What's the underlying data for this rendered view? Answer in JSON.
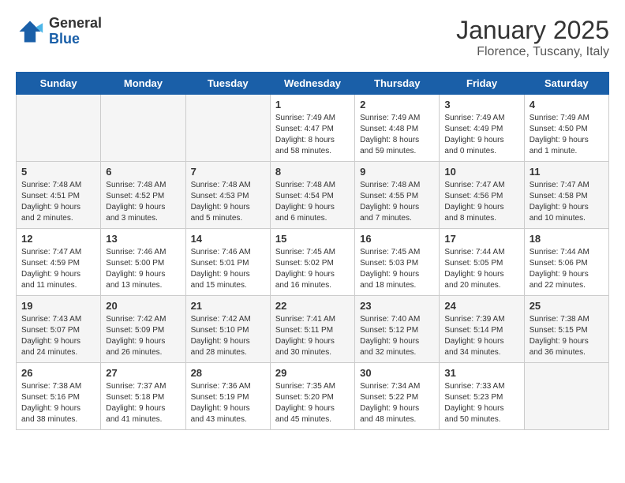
{
  "logo": {
    "general": "General",
    "blue": "Blue"
  },
  "title": "January 2025",
  "subtitle": "Florence, Tuscany, Italy",
  "weekdays": [
    "Sunday",
    "Monday",
    "Tuesday",
    "Wednesday",
    "Thursday",
    "Friday",
    "Saturday"
  ],
  "weeks": [
    [
      {
        "day": "",
        "info": ""
      },
      {
        "day": "",
        "info": ""
      },
      {
        "day": "",
        "info": ""
      },
      {
        "day": "1",
        "info": "Sunrise: 7:49 AM\nSunset: 4:47 PM\nDaylight: 8 hours and 58 minutes."
      },
      {
        "day": "2",
        "info": "Sunrise: 7:49 AM\nSunset: 4:48 PM\nDaylight: 8 hours and 59 minutes."
      },
      {
        "day": "3",
        "info": "Sunrise: 7:49 AM\nSunset: 4:49 PM\nDaylight: 9 hours and 0 minutes."
      },
      {
        "day": "4",
        "info": "Sunrise: 7:49 AM\nSunset: 4:50 PM\nDaylight: 9 hours and 1 minute."
      }
    ],
    [
      {
        "day": "5",
        "info": "Sunrise: 7:48 AM\nSunset: 4:51 PM\nDaylight: 9 hours and 2 minutes."
      },
      {
        "day": "6",
        "info": "Sunrise: 7:48 AM\nSunset: 4:52 PM\nDaylight: 9 hours and 3 minutes."
      },
      {
        "day": "7",
        "info": "Sunrise: 7:48 AM\nSunset: 4:53 PM\nDaylight: 9 hours and 5 minutes."
      },
      {
        "day": "8",
        "info": "Sunrise: 7:48 AM\nSunset: 4:54 PM\nDaylight: 9 hours and 6 minutes."
      },
      {
        "day": "9",
        "info": "Sunrise: 7:48 AM\nSunset: 4:55 PM\nDaylight: 9 hours and 7 minutes."
      },
      {
        "day": "10",
        "info": "Sunrise: 7:47 AM\nSunset: 4:56 PM\nDaylight: 9 hours and 8 minutes."
      },
      {
        "day": "11",
        "info": "Sunrise: 7:47 AM\nSunset: 4:58 PM\nDaylight: 9 hours and 10 minutes."
      }
    ],
    [
      {
        "day": "12",
        "info": "Sunrise: 7:47 AM\nSunset: 4:59 PM\nDaylight: 9 hours and 11 minutes."
      },
      {
        "day": "13",
        "info": "Sunrise: 7:46 AM\nSunset: 5:00 PM\nDaylight: 9 hours and 13 minutes."
      },
      {
        "day": "14",
        "info": "Sunrise: 7:46 AM\nSunset: 5:01 PM\nDaylight: 9 hours and 15 minutes."
      },
      {
        "day": "15",
        "info": "Sunrise: 7:45 AM\nSunset: 5:02 PM\nDaylight: 9 hours and 16 minutes."
      },
      {
        "day": "16",
        "info": "Sunrise: 7:45 AM\nSunset: 5:03 PM\nDaylight: 9 hours and 18 minutes."
      },
      {
        "day": "17",
        "info": "Sunrise: 7:44 AM\nSunset: 5:05 PM\nDaylight: 9 hours and 20 minutes."
      },
      {
        "day": "18",
        "info": "Sunrise: 7:44 AM\nSunset: 5:06 PM\nDaylight: 9 hours and 22 minutes."
      }
    ],
    [
      {
        "day": "19",
        "info": "Sunrise: 7:43 AM\nSunset: 5:07 PM\nDaylight: 9 hours and 24 minutes."
      },
      {
        "day": "20",
        "info": "Sunrise: 7:42 AM\nSunset: 5:09 PM\nDaylight: 9 hours and 26 minutes."
      },
      {
        "day": "21",
        "info": "Sunrise: 7:42 AM\nSunset: 5:10 PM\nDaylight: 9 hours and 28 minutes."
      },
      {
        "day": "22",
        "info": "Sunrise: 7:41 AM\nSunset: 5:11 PM\nDaylight: 9 hours and 30 minutes."
      },
      {
        "day": "23",
        "info": "Sunrise: 7:40 AM\nSunset: 5:12 PM\nDaylight: 9 hours and 32 minutes."
      },
      {
        "day": "24",
        "info": "Sunrise: 7:39 AM\nSunset: 5:14 PM\nDaylight: 9 hours and 34 minutes."
      },
      {
        "day": "25",
        "info": "Sunrise: 7:38 AM\nSunset: 5:15 PM\nDaylight: 9 hours and 36 minutes."
      }
    ],
    [
      {
        "day": "26",
        "info": "Sunrise: 7:38 AM\nSunset: 5:16 PM\nDaylight: 9 hours and 38 minutes."
      },
      {
        "day": "27",
        "info": "Sunrise: 7:37 AM\nSunset: 5:18 PM\nDaylight: 9 hours and 41 minutes."
      },
      {
        "day": "28",
        "info": "Sunrise: 7:36 AM\nSunset: 5:19 PM\nDaylight: 9 hours and 43 minutes."
      },
      {
        "day": "29",
        "info": "Sunrise: 7:35 AM\nSunset: 5:20 PM\nDaylight: 9 hours and 45 minutes."
      },
      {
        "day": "30",
        "info": "Sunrise: 7:34 AM\nSunset: 5:22 PM\nDaylight: 9 hours and 48 minutes."
      },
      {
        "day": "31",
        "info": "Sunrise: 7:33 AM\nSunset: 5:23 PM\nDaylight: 9 hours and 50 minutes."
      },
      {
        "day": "",
        "info": ""
      }
    ]
  ]
}
